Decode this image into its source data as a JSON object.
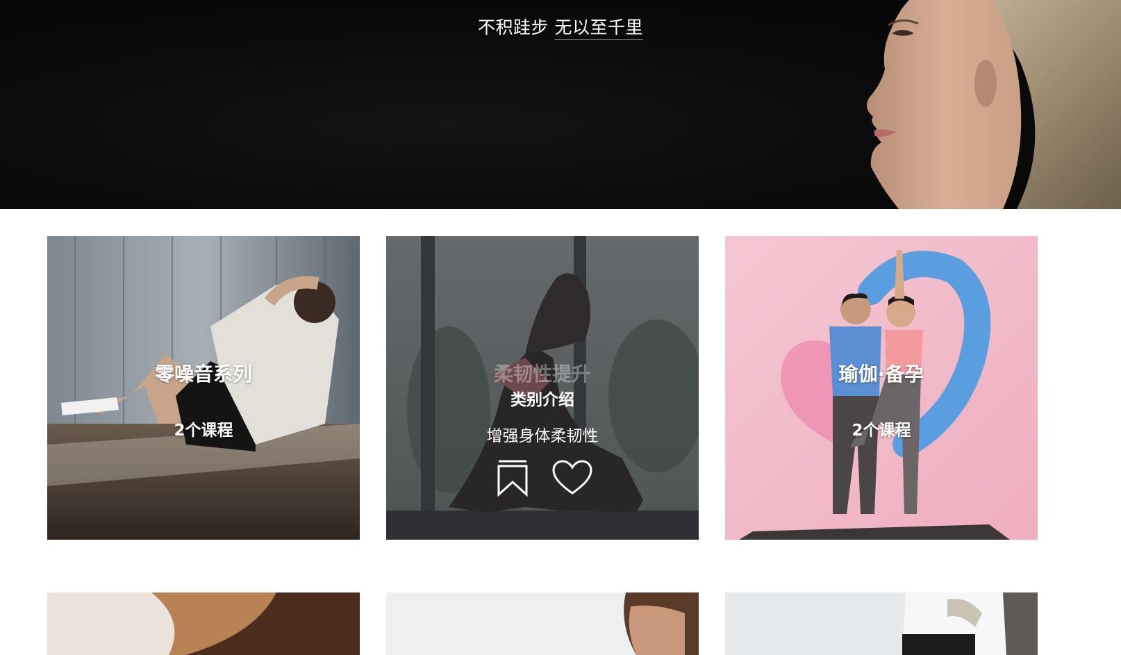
{
  "hero": {
    "slogan_part1": "不积跬步",
    "slogan_part2": "无以至千里"
  },
  "cards": [
    {
      "title": "零噪音系列",
      "count": "2个课程"
    },
    {
      "title": "柔韧性提升",
      "subtitle": "类别介绍",
      "description": "增强身体柔韧性",
      "icons": [
        "bookmark-icon",
        "heart-icon"
      ]
    },
    {
      "title": "瑜伽·备孕",
      "count": "2个课程"
    }
  ],
  "colors": {
    "hero_background": "#0a0a0a",
    "card_overlay": "#28282c",
    "yoga_pink": "#f0b7c8",
    "heart_blue": "#5b9ee0"
  }
}
